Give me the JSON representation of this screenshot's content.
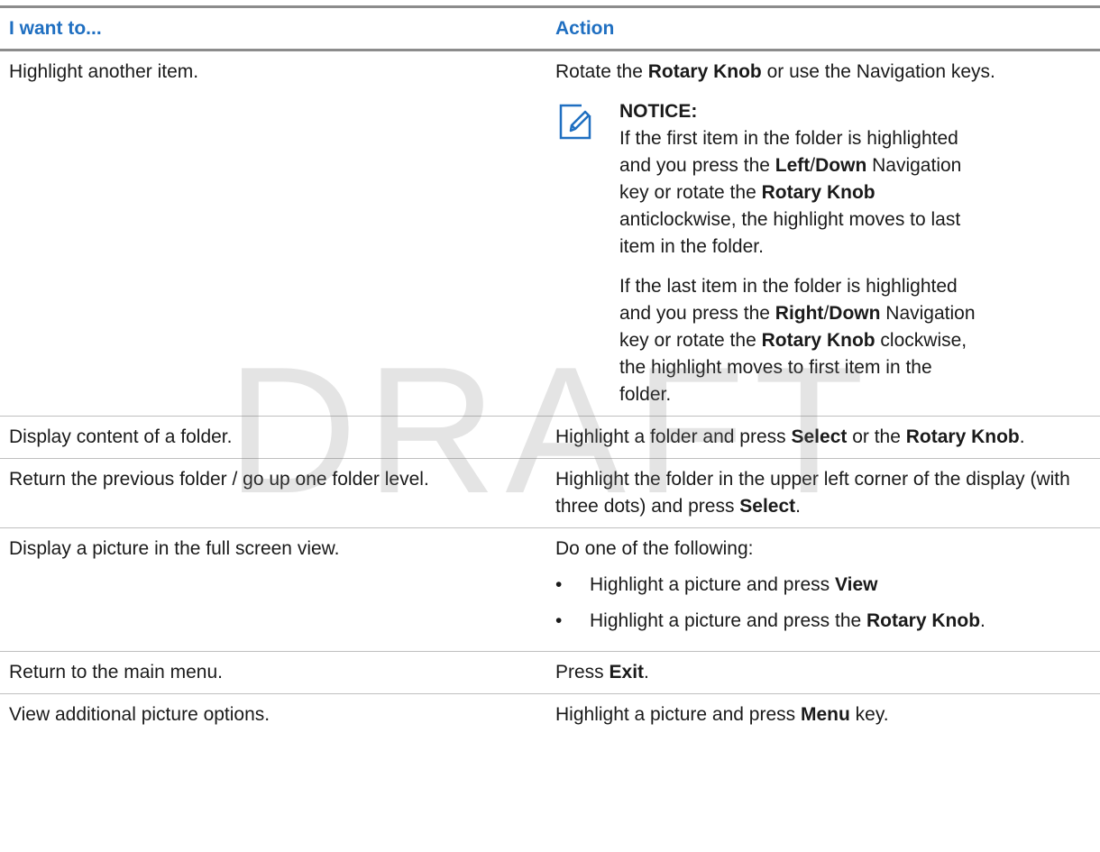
{
  "table": {
    "headers": {
      "want": "I want to...",
      "action": "Action"
    },
    "rows": [
      {
        "want": "Highlight another item.",
        "action": {
          "t1": "Rotate the ",
          "b1": "Rotary Knob",
          "t2": " or use the Navigation keys."
        },
        "notice": {
          "icon": "notice-icon",
          "title": "NOTICE:",
          "p1": {
            "t1": "If the first item in the folder is highlighted and you press the ",
            "b1": "Left",
            "t2": "/",
            "b2": "Down",
            "t3": " Navigation key or rotate the ",
            "b3": "Rotary Knob",
            "t4": " anticlockwise, the highlight moves to last item in the folder."
          },
          "p2": {
            "t1": "If the last item in the folder is highlighted and you press the ",
            "b1": "Right",
            "t2": "/",
            "b2": "Down",
            "t3": " Navigation key or rotate the ",
            "b3": "Rotary Knob",
            "t4": " clockwise, the highlight moves to first item in the folder."
          }
        }
      },
      {
        "want": "Display content of a folder.",
        "action": {
          "t1": "Highlight a folder and press ",
          "b1": "Select",
          "t2": " or the ",
          "b2": "Rotary Knob",
          "t3": "."
        }
      },
      {
        "want": "Return the previous folder / go up one folder level.",
        "action": {
          "t1": "Highlight the folder in the upper left corner of the display (with three dots) and press ",
          "b1": "Select",
          "t2": "."
        }
      },
      {
        "want": "Display a picture in the full screen view.",
        "action": {
          "intro": "Do one of the following:",
          "bullet": "•",
          "items": [
            {
              "t1": "Highlight a picture and press ",
              "b1": "View"
            },
            {
              "t1": "Highlight a picture and press the ",
              "b1": "Rotary Knob",
              "t2": "."
            }
          ]
        }
      },
      {
        "want": "Return to the main menu.",
        "action": {
          "t1": "Press ",
          "b1": "Exit",
          "t2": "."
        }
      },
      {
        "want": "View additional picture options.",
        "action": {
          "t1": "Highlight a picture and press ",
          "b1": "Menu",
          "t2": " key."
        }
      }
    ]
  },
  "watermark": "DRAFT",
  "colors": {
    "header_text": "#1f6fc1",
    "icon": "#1f6fc1",
    "rule": "#8c8c8c"
  }
}
